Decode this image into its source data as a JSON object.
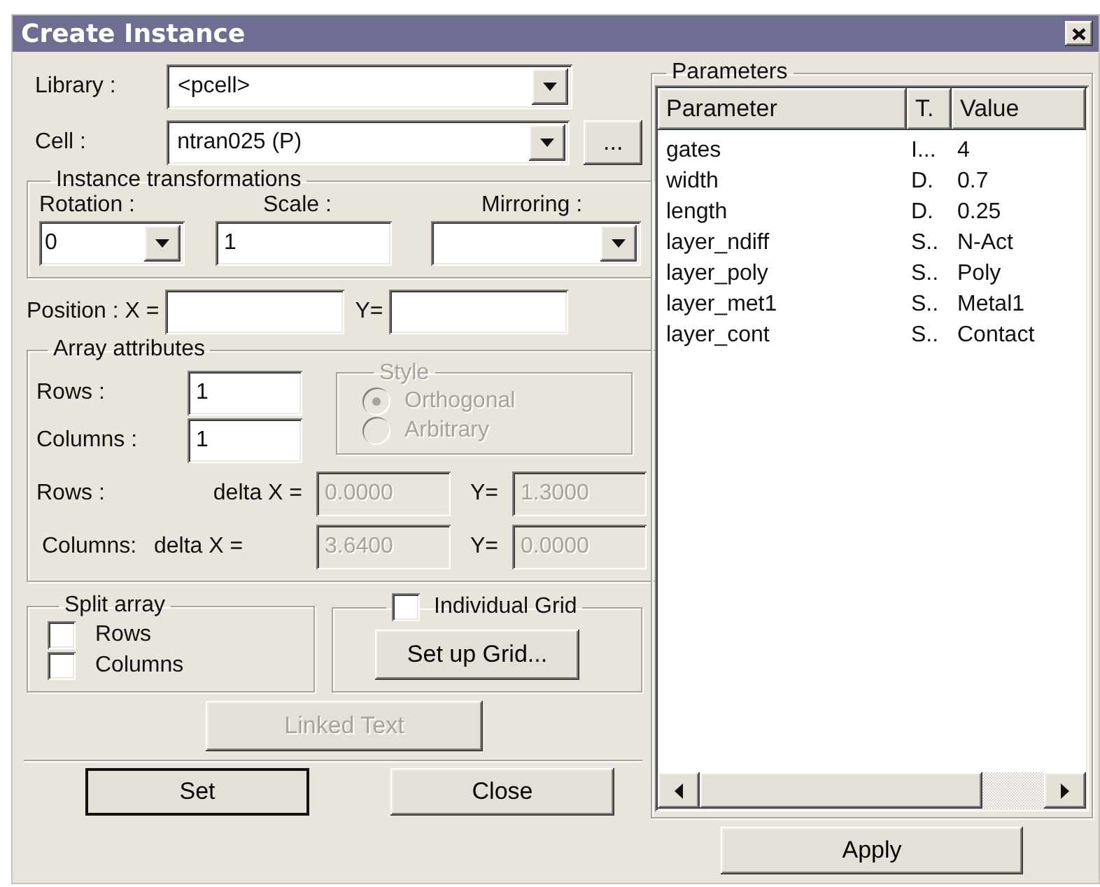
{
  "window": {
    "title": "Create Instance"
  },
  "library": {
    "label": "Library :",
    "value": "<pcell>"
  },
  "cell": {
    "label": "Cell :",
    "value": "ntran025 (P)",
    "browse_button": "..."
  },
  "transformations": {
    "title": "Instance transformations",
    "rotation": {
      "label": "Rotation :",
      "value": "0"
    },
    "scale": {
      "label": "Scale :",
      "value": "1"
    },
    "mirroring": {
      "label": "Mirroring :"
    }
  },
  "position": {
    "x_label": "Position : X =",
    "y_label": "Y="
  },
  "array": {
    "title": "Array attributes",
    "rows": {
      "label": "Rows :",
      "value": "1"
    },
    "columns": {
      "label": "Columns :",
      "value": "1"
    },
    "style": {
      "title": "Style",
      "disabled": true,
      "options": [
        {
          "label": "Orthogonal",
          "selected": true
        },
        {
          "label": "Arbitrary",
          "selected": false
        }
      ]
    },
    "deltas": [
      {
        "label": "Rows :",
        "x_label": "delta X =",
        "x_value": "0.0000",
        "y_label": "Y=",
        "y_value": "1.3000",
        "disabled": true
      },
      {
        "label": "Columns:",
        "x_label": "delta X =",
        "x_value": "3.6400",
        "y_label": "Y=",
        "y_value": "0.0000",
        "disabled": true
      }
    ]
  },
  "split_array": {
    "title": "Split array",
    "options": [
      {
        "label": "Rows",
        "checked": false
      },
      {
        "label": "Columns",
        "checked": false
      }
    ]
  },
  "individual_grid": {
    "label": "Individual Grid",
    "checked": false,
    "button": "Set up Grid..."
  },
  "linked_text": {
    "label": "Linked Text",
    "disabled": true
  },
  "buttons": [
    {
      "label": "Set",
      "default": true
    },
    {
      "label": "Close",
      "default": false
    }
  ],
  "parameters": {
    "title": "Parameters",
    "columns": [
      "Parameter",
      "T.",
      "Value"
    ],
    "rows": [
      {
        "name": "gates",
        "type": "I...",
        "value": "4"
      },
      {
        "name": "width",
        "type": "D.",
        "value": "0.7"
      },
      {
        "name": "length",
        "type": "D.",
        "value": "0.25"
      },
      {
        "name": "layer_ndiff",
        "type": "S..",
        "value": "N-Act"
      },
      {
        "name": "layer_poly",
        "type": "S..",
        "value": "Poly"
      },
      {
        "name": "layer_met1",
        "type": "S..",
        "value": "Metal1"
      },
      {
        "name": "layer_cont",
        "type": "S..",
        "value": "Contact"
      }
    ],
    "apply": "Apply"
  }
}
